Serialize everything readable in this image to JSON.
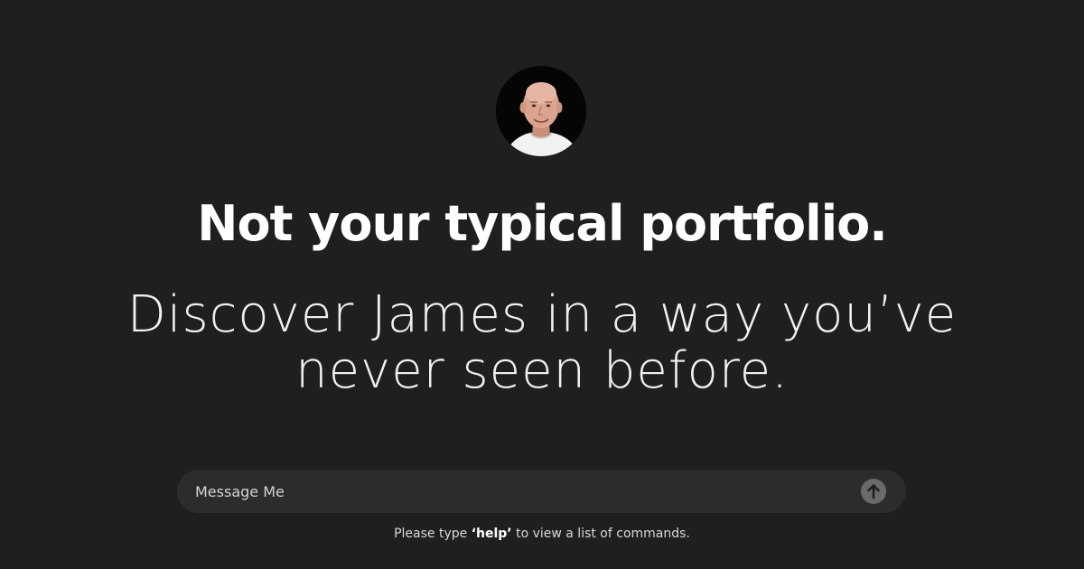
{
  "profile": {
    "avatar_icon": "person-photo"
  },
  "hero": {
    "headline": "Not your typical portfolio.",
    "subhead_line1": "Discover James in a way you’ve",
    "subhead_line2": "never seen before."
  },
  "message_bar": {
    "placeholder": "Message Me",
    "value": "",
    "send_icon": "arrow-up-icon"
  },
  "hint": {
    "prefix": "Please type ",
    "command": "‘help’",
    "suffix": " to view a list of commands."
  },
  "colors": {
    "background": "#1f1f1f",
    "input_background": "#2c2c2c",
    "send_button": "#6a6a6a",
    "text": "#ffffff"
  }
}
